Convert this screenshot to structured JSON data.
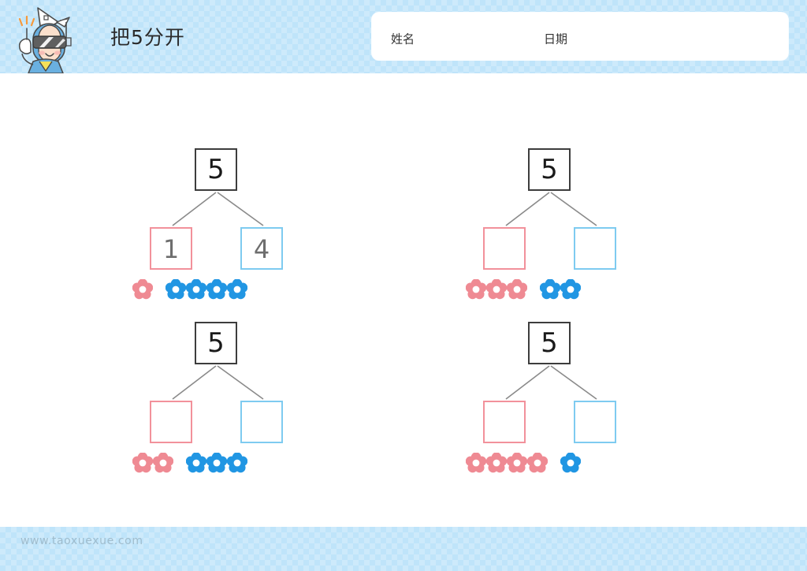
{
  "header": {
    "title": "把5分开",
    "mascot_icon": "mascot-vr-character-icon",
    "name_label": "姓名",
    "date_label": "日期",
    "name_value": "",
    "date_value": ""
  },
  "footer": {
    "site": "www.taoxuexue.com"
  },
  "colors": {
    "band": "#cdeafb",
    "band_check": "#bfe4fa",
    "red": "#ef8a93",
    "blue": "#2196e3",
    "red_border": "#f2919b",
    "blue_border": "#7ecbf0",
    "top_border": "#3d3d3d",
    "answer_text": "#6e6e6e",
    "footer_text": "#9fbccd"
  },
  "worksheet": {
    "whole": "5",
    "problems": [
      {
        "whole": "5",
        "left_value": "1",
        "right_value": "4",
        "red_flowers": 1,
        "blue_flowers": 4,
        "filled": true
      },
      {
        "whole": "5",
        "left_value": "",
        "right_value": "",
        "red_flowers": 3,
        "blue_flowers": 2,
        "filled": false
      },
      {
        "whole": "5",
        "left_value": "",
        "right_value": "",
        "red_flowers": 2,
        "blue_flowers": 3,
        "filled": false
      },
      {
        "whole": "5",
        "left_value": "",
        "right_value": "",
        "red_flowers": 4,
        "blue_flowers": 1,
        "filled": false
      }
    ]
  }
}
